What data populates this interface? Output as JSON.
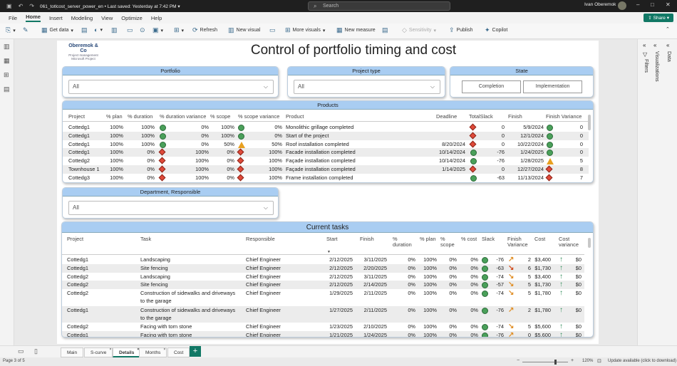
{
  "window": {
    "file_name": "061_totlcost_server_power_en",
    "saved_status": "Last saved: Yesterday at 7:42 PM",
    "search_placeholder": "Search",
    "user_name": "Ivan Oberemok"
  },
  "menu": [
    "File",
    "Home",
    "Insert",
    "Modeling",
    "View",
    "Optimize",
    "Help"
  ],
  "share_label": "Share",
  "ribbon": {
    "get_data": "Get data",
    "refresh": "Refresh",
    "new_visual": "New visual",
    "more_visuals": "More visuals",
    "new_measure": "New measure",
    "sensitivity": "Sensitivity",
    "publish": "Publish",
    "copilot": "Copilot"
  },
  "panes": {
    "filters": "Filters",
    "visualizations": "Visualizations",
    "data": "Data"
  },
  "logo": {
    "name": "Oberemok & Co",
    "line1": "Project management",
    "line2": "Microsoft Project"
  },
  "page_title": "Control of portfolio timing and cost",
  "slicers": {
    "portfolio": {
      "title": "Portfolio",
      "value": "All"
    },
    "project_type": {
      "title": "Project type",
      "value": "All"
    },
    "state": {
      "title": "State",
      "buttons": [
        "Completion",
        "Implementation"
      ]
    },
    "department": {
      "title": "Department, Responsible",
      "value": "All"
    }
  },
  "products": {
    "title": "Products",
    "columns": [
      "Project",
      "% plan",
      "% duration",
      "% duration variance",
      "% scope",
      "% scope variance",
      "Product",
      "Deadline",
      "TotalSlack",
      "Finish",
      "Finish Variance"
    ],
    "rows": [
      {
        "project": "Cottedg1",
        "plan": "100%",
        "duration": "100%",
        "dur_ind": "dot",
        "dur_var": "0%",
        "scope": "100%",
        "scope_ind": "dot",
        "scope_var": "0%",
        "product": "Monolithic grillage completed",
        "deadline": "",
        "slack_ind": "dia",
        "slack": "0",
        "finish": "5/9/2024",
        "fin_ind": "dot",
        "fin_var": "0"
      },
      {
        "project": "Cottedg1",
        "plan": "100%",
        "duration": "100%",
        "dur_ind": "dot",
        "dur_var": "0%",
        "scope": "100%",
        "scope_ind": "dot",
        "scope_var": "0%",
        "product": "Start of the project",
        "deadline": "",
        "slack_ind": "dia",
        "slack": "0",
        "finish": "12/1/2024",
        "fin_ind": "dot",
        "fin_var": "0"
      },
      {
        "project": "Cottedg1",
        "plan": "100%",
        "duration": "100%",
        "dur_ind": "dot",
        "dur_var": "0%",
        "scope": "50%",
        "scope_ind": "tri",
        "scope_var": "50%",
        "product": "Roof installation completed",
        "deadline": "8/20/2024",
        "slack_ind": "dia",
        "slack": "0",
        "finish": "10/22/2024",
        "fin_ind": "dot",
        "fin_var": "0"
      },
      {
        "project": "Cottedg1",
        "plan": "100%",
        "duration": "0%",
        "dur_ind": "dia",
        "dur_var": "100%",
        "scope": "0%",
        "scope_ind": "dia",
        "scope_var": "100%",
        "product": "Facade installation completed",
        "deadline": "10/14/2024",
        "slack_ind": "dot",
        "slack": "-76",
        "finish": "1/24/2025",
        "fin_ind": "dot",
        "fin_var": "0"
      },
      {
        "project": "Cottedg2",
        "plan": "100%",
        "duration": "0%",
        "dur_ind": "dia",
        "dur_var": "100%",
        "scope": "0%",
        "scope_ind": "dia",
        "scope_var": "100%",
        "product": "Façade installation completed",
        "deadline": "10/14/2024",
        "slack_ind": "dot",
        "slack": "-76",
        "finish": "1/28/2025",
        "fin_ind": "tri",
        "fin_var": "5"
      },
      {
        "project": "Townhouse 1",
        "plan": "100%",
        "duration": "0%",
        "dur_ind": "dia",
        "dur_var": "100%",
        "scope": "0%",
        "scope_ind": "dia",
        "scope_var": "100%",
        "product": "Façade installation completed",
        "deadline": "1/14/2025",
        "slack_ind": "dia",
        "slack": "0",
        "finish": "12/27/2024",
        "fin_ind": "dia",
        "fin_var": "8"
      },
      {
        "project": "Cottedg3",
        "plan": "100%",
        "duration": "0%",
        "dur_ind": "dia",
        "dur_var": "100%",
        "scope": "0%",
        "scope_ind": "dia",
        "scope_var": "100%",
        "product": "Frame installation completed",
        "deadline": "",
        "slack_ind": "dot",
        "slack": "-63",
        "finish": "11/13/2024",
        "fin_ind": "dia",
        "fin_var": "7"
      }
    ]
  },
  "tasks": {
    "title": "Current tasks",
    "columns": {
      "project": "Project",
      "task": "Task",
      "responsible": "Responsible",
      "start": "Start",
      "finish": "Finish",
      "pct_duration": "% duration",
      "pct_plan": "% plan",
      "pct_scope": "% scope",
      "pct_cost": "% cost",
      "slack": "Slack",
      "finish_variance": "Finish Variance",
      "cost": "Cost",
      "cost_variance": "Cost variance"
    },
    "rows": [
      {
        "project": "Cottedg1",
        "task": "Landscaping",
        "task2": "",
        "responsible": "Chief Engineer",
        "start": "2/12/2025",
        "finish": "3/11/2025",
        "dur": "0%",
        "plan": "100%",
        "scope": "0%",
        "cost": "0%",
        "slack": "-76",
        "fv_dir": "up",
        "fv": "2",
        "costv": "$3,400",
        "cv_dir": "up",
        "cv": "$0"
      },
      {
        "project": "Cottedg1",
        "task": "Site fencing",
        "task2": "",
        "responsible": "Chief Engineer",
        "start": "2/12/2025",
        "finish": "2/20/2025",
        "dur": "0%",
        "plan": "100%",
        "scope": "0%",
        "cost": "0%",
        "slack": "-63",
        "fv_dir": "down",
        "fv": "6",
        "costv": "$1,730",
        "cv_dir": "up",
        "cv": "$0"
      },
      {
        "project": "Cottedg2",
        "task": "Landscaping",
        "task2": "",
        "responsible": "Chief Engineer",
        "start": "2/12/2025",
        "finish": "3/11/2025",
        "dur": "0%",
        "plan": "100%",
        "scope": "0%",
        "cost": "0%",
        "slack": "-74",
        "fv_dir": "mid",
        "fv": "5",
        "costv": "$3,400",
        "cv_dir": "up",
        "cv": "$0"
      },
      {
        "project": "Cottedg2",
        "task": "Site fencing",
        "task2": "",
        "responsible": "Chief Engineer",
        "start": "2/12/2025",
        "finish": "2/14/2025",
        "dur": "0%",
        "plan": "100%",
        "scope": "0%",
        "cost": "0%",
        "slack": "-57",
        "fv_dir": "mid",
        "fv": "5",
        "costv": "$1,730",
        "cv_dir": "up",
        "cv": "$0"
      },
      {
        "project": "Cottedg2",
        "task": "Construction of sidewalks and driveways",
        "task2": "to the garage",
        "responsible": "Chief Engineer",
        "start": "1/29/2025",
        "finish": "2/11/2025",
        "dur": "0%",
        "plan": "100%",
        "scope": "0%",
        "cost": "0%",
        "slack": "-74",
        "fv_dir": "mid",
        "fv": "5",
        "costv": "$1,780",
        "cv_dir": "up",
        "cv": "$0"
      },
      {
        "project": "Cottedg1",
        "task": "Construction of sidewalks and driveways",
        "task2": "to the garage",
        "responsible": "Chief Engineer",
        "start": "1/27/2025",
        "finish": "2/11/2025",
        "dur": "0%",
        "plan": "100%",
        "scope": "0%",
        "cost": "0%",
        "slack": "-76",
        "fv_dir": "up",
        "fv": "2",
        "costv": "$1,780",
        "cv_dir": "up",
        "cv": "$0"
      },
      {
        "project": "Cottedg2",
        "task": "Facing with torn stone",
        "task2": "",
        "responsible": "Chief Engineer",
        "start": "1/23/2025",
        "finish": "2/10/2025",
        "dur": "0%",
        "plan": "100%",
        "scope": "0%",
        "cost": "0%",
        "slack": "-74",
        "fv_dir": "mid",
        "fv": "5",
        "costv": "$5,600",
        "cv_dir": "up",
        "cv": "$0"
      },
      {
        "project": "Cottedg1",
        "task": "Facing with torn stone",
        "task2": "",
        "responsible": "Chief Engineer",
        "start": "1/21/2025",
        "finish": "1/24/2025",
        "dur": "0%",
        "plan": "100%",
        "scope": "0%",
        "cost": "0%",
        "slack": "-76",
        "fv_dir": "up",
        "fv": "0",
        "costv": "$5,600",
        "cv_dir": "up",
        "cv": "$0"
      }
    ]
  },
  "page_tabs": [
    "Main",
    "S-curve",
    "Details",
    "Months",
    "Cost"
  ],
  "active_tab": "Details",
  "status": {
    "page": "Page 3 of 5",
    "zoom": "120%",
    "update": "Update available (click to download)"
  }
}
